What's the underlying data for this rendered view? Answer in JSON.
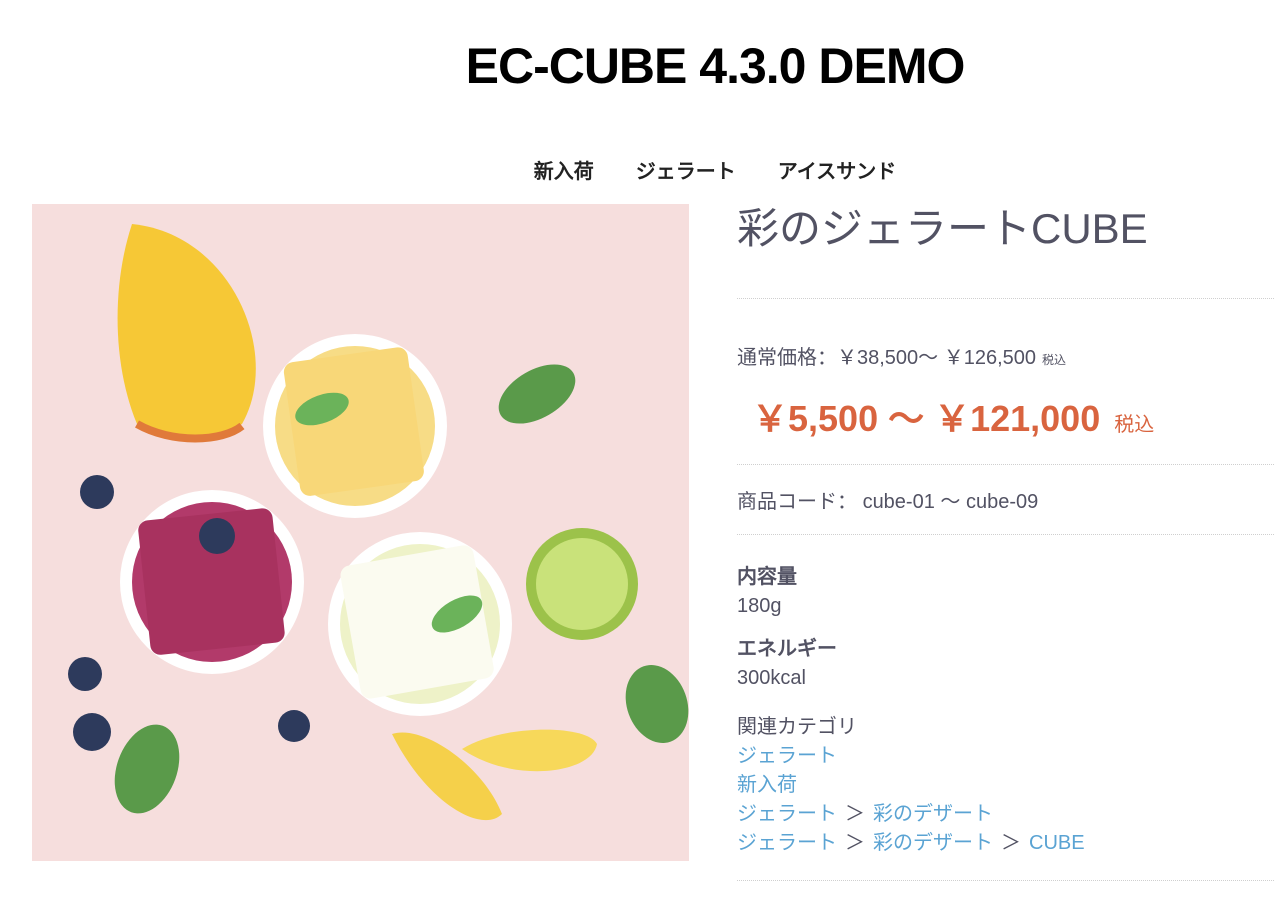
{
  "header": {
    "site_title": "EC-CUBE 4.3.0 DEMO"
  },
  "nav": {
    "items": [
      "新入荷",
      "ジェラート",
      "アイスサンド"
    ]
  },
  "product": {
    "name": "彩のジェラートCUBE",
    "regular_price_label": "通常価格：",
    "regular_price": "￥38,500～ ￥126,500",
    "regular_tax": "税込",
    "sale_price": "￥5,500 ～ ￥121,000",
    "sale_tax": "税込",
    "code_label": "商品コード：",
    "code": "cube-01 ～ cube-09",
    "specs": [
      {
        "label": "内容量",
        "value": "180g"
      },
      {
        "label": "エネルギー",
        "value": "300kcal"
      }
    ],
    "related_label": "関連カテゴリ",
    "related": {
      "row1": "ジェラート",
      "row2": "新入荷",
      "row3": [
        "ジェラート",
        "彩のデザート"
      ],
      "row4": [
        "ジェラート",
        "彩のデザート",
        "CUBE"
      ],
      "separator": "＞"
    }
  },
  "colors": {
    "accent_price": "#d9643f",
    "link": "#5aa3d3",
    "text": "#525263",
    "photo_bg": "#f6dedd"
  }
}
